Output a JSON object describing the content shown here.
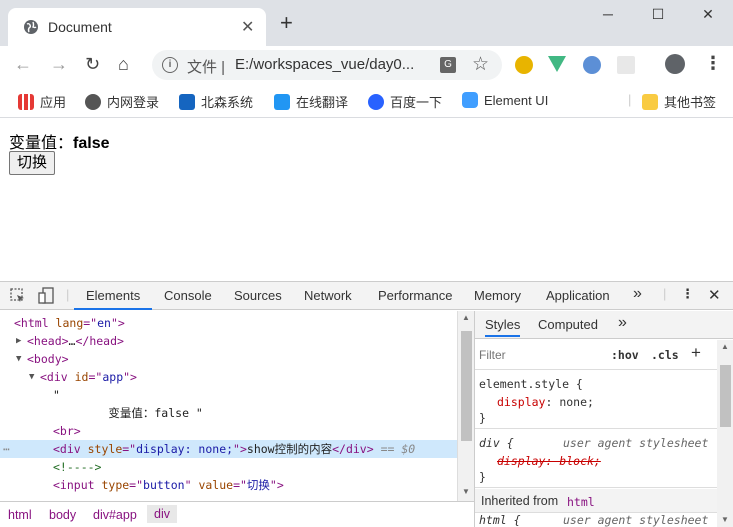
{
  "browser": {
    "tab_title": "Document",
    "url_prefix": "文件",
    "url": "E:/workspaces_vue/day0...",
    "win_controls": [
      "─",
      "☐",
      "✕"
    ],
    "nav_icons": [
      "back-icon",
      "forward-icon",
      "reload-icon",
      "home-icon"
    ]
  },
  "bookmarks": [
    {
      "label": "应用",
      "icon": "apps-grid-icon",
      "color": "#e53935"
    },
    {
      "label": "内网登录",
      "icon": "globe-icon",
      "color": "#555555"
    },
    {
      "label": "北森系统",
      "icon": "info-square-icon",
      "color": "#1565c0"
    },
    {
      "label": "在线翻译",
      "icon": "translate-d-icon",
      "color": "#2196f3"
    },
    {
      "label": "百度一下",
      "icon": "paw-icon",
      "color": "#2962ff"
    },
    {
      "label": "Element UI",
      "icon": "element-ui-icon",
      "color": "#409eff"
    }
  ],
  "bookmarks_other": "其他书签",
  "page": {
    "var_label": "变量值：",
    "var_value": "false",
    "button_label": "切换"
  },
  "devtools": {
    "tabs": [
      "Elements",
      "Console",
      "Sources",
      "Network",
      "Performance",
      "Memory",
      "Application"
    ],
    "more": "»",
    "elements": [
      {
        "indent": 0,
        "arrow": "",
        "html": "&lt;html <span class='attr'>lang</span>=\"<span class='val'>en</span>\"&gt;"
      },
      {
        "indent": 1,
        "arrow": "▶",
        "html": "&lt;head&gt;<span class='txt'>…</span>&lt;/head&gt;"
      },
      {
        "indent": 1,
        "arrow": "▼",
        "html": "&lt;body&gt;"
      },
      {
        "indent": 2,
        "arrow": "▼",
        "html": "&lt;div <span class='attr'>id</span>=\"<span class='val'>app</span>\"&gt;"
      },
      {
        "indent": 3,
        "arrow": "",
        "html": "<span class='txt'>\"</span>"
      },
      {
        "indent": 3,
        "arrow": "",
        "html": "<span class='txt'>&nbsp;&nbsp;&nbsp;&nbsp;&nbsp;&nbsp;&nbsp;&nbsp;变量值：false \"</span>"
      },
      {
        "indent": 3,
        "arrow": "",
        "html": "&lt;br&gt;"
      },
      {
        "indent": 3,
        "arrow": "",
        "html": "&lt;div <span class='attr'>style</span>=\"<span class='val'>display: none;</span>\"&gt;<span class='txt'>show控制的内容</span>&lt;/div&gt; <span class='dollar'>== $0</span>",
        "selected": true
      },
      {
        "indent": 3,
        "arrow": "",
        "html": "<span class='cmt'>&lt;!----&gt;</span>"
      },
      {
        "indent": 3,
        "arrow": "",
        "html": "&lt;input <span class='attr'>type</span>=\"<span class='val'>button</span>\" <span class='attr'>value</span>=\"<span class='val'>切换</span>\"&gt;"
      }
    ],
    "styles_tabs": [
      "Styles",
      "Computed"
    ],
    "filter_placeholder": "Filter",
    "hov": ":hov",
    "cls": ".cls",
    "plus": "+",
    "element_style_selector": "element.style {",
    "element_style_prop": "display",
    "element_style_value": "none;",
    "close_brace": "}",
    "ua_selector": "div {",
    "ua_source": "user agent stylesheet",
    "ua_prop": "display: block;",
    "inherited_label": "Inherited from",
    "inherited_tag": "html",
    "html_selector": "html {",
    "html_source": "user agent stylesheet",
    "breadcrumb": [
      "html",
      "body",
      "div#app",
      "div"
    ]
  }
}
